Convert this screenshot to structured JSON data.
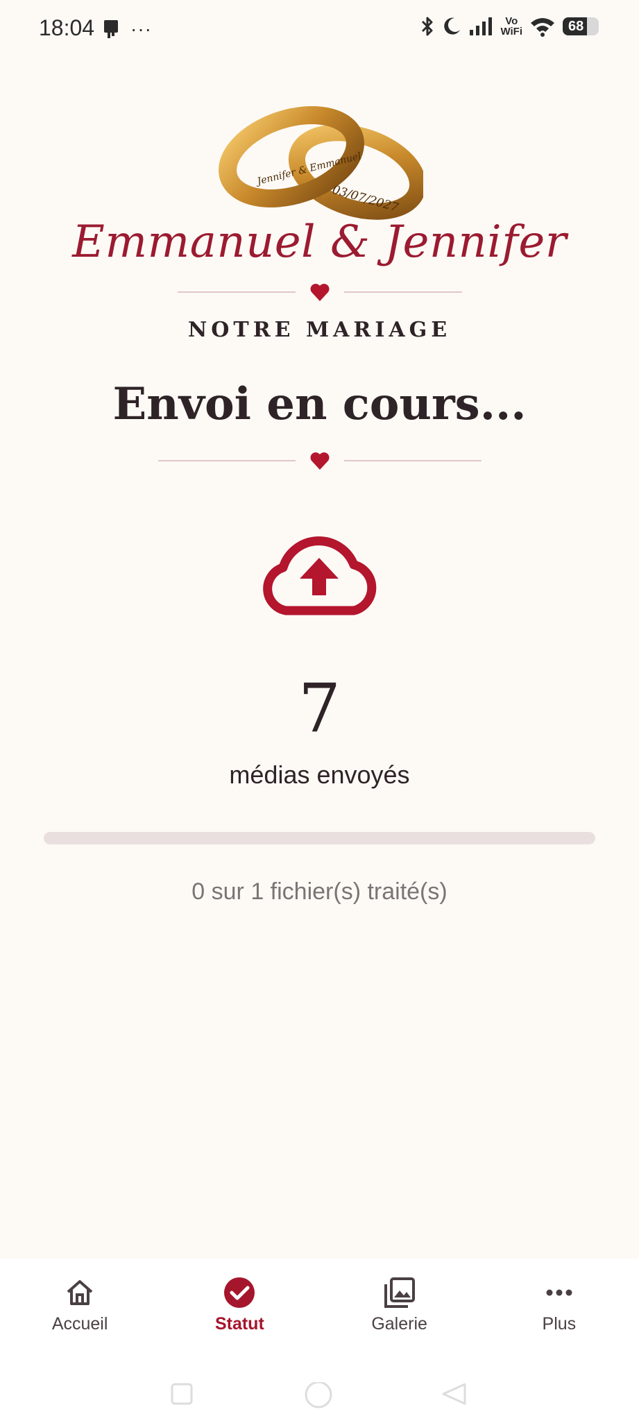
{
  "status_bar": {
    "time": "18:04",
    "more": "···",
    "network_label_top": "Vo",
    "network_label_bottom": "WiFi",
    "battery": "68",
    "icons": [
      "device-icon",
      "bluetooth-icon",
      "moon-icon",
      "signal-icon",
      "wifi-icon",
      "battery-icon"
    ]
  },
  "header": {
    "ring_engraving_1": "Jennifer & Emmanuel",
    "ring_engraving_2": "03/07/2027",
    "couple_names": "Emmanuel & Jennifer",
    "subtitle": "NOTRE MARIAGE"
  },
  "main": {
    "title": "Envoi en cours...",
    "icon": "cloud-upload-icon",
    "media_count": "7",
    "media_label": "médias envoyés",
    "progress_fraction": 0,
    "progress_text": "0 sur 1 fichier(s) traité(s)"
  },
  "bottom_nav": {
    "items": [
      {
        "label": "Accueil",
        "icon": "home-icon",
        "active": false
      },
      {
        "label": "Statut",
        "icon": "check-circle-icon",
        "active": true
      },
      {
        "label": "Galerie",
        "icon": "gallery-icon",
        "active": false
      },
      {
        "label": "Plus",
        "icon": "more-icon",
        "active": false
      }
    ]
  },
  "colors": {
    "accent": "#9b1b30",
    "background": "#fdfaf6",
    "text": "#2e2326",
    "muted": "#7c7474",
    "ring_gold": "#c8892b"
  }
}
